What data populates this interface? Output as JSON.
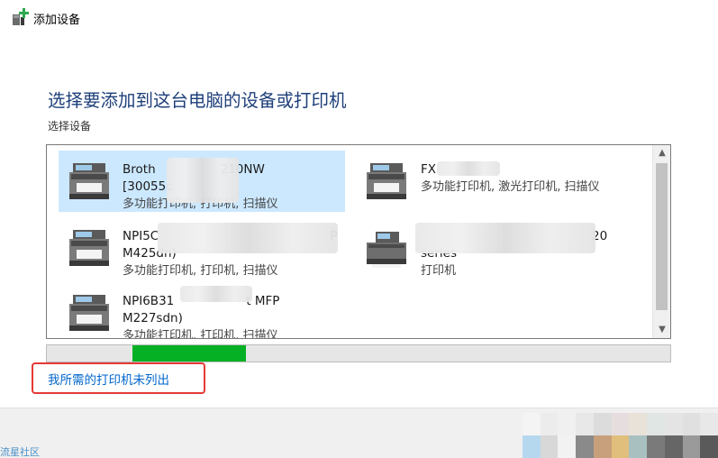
{
  "window": {
    "title": "添加设备",
    "icon": "add-device-icon"
  },
  "heading": "选择要添加到这台电脑的设备或打印机",
  "subheading": "选择设备",
  "devices": [
    {
      "line1": "Broth",
      "line1_tail": "210NW",
      "line2": "[30055c",
      "line3": "多功能打印机, 打印机, 扫描仪",
      "icon": "multifunction-printer-icon",
      "selected": true
    },
    {
      "line1": "FX",
      "line1_tail": "",
      "line2": "",
      "line3": "多功能打印机, 激光打印机, 扫描仪",
      "icon": "multifunction-printer-icon",
      "selected": false
    },
    {
      "line1": "NPI5C",
      "line1_tail": "P",
      "line2": "M425dn)",
      "line3": "多功能打印机, 打印机, 扫描仪",
      "icon": "multifunction-printer-icon",
      "selected": false
    },
    {
      "line1": "",
      "line1_tail": "20",
      "line2": "series",
      "line3": "打印机",
      "icon": "printer-icon",
      "selected": false
    },
    {
      "line1": "NPI6B31",
      "line1_tail": "t MFP",
      "line2": "M227sdn)",
      "line3": "多功能打印机, 打印机, 扫描仪",
      "icon": "multifunction-printer-icon",
      "selected": false
    }
  ],
  "progress": {
    "start_fraction": 0.137,
    "end_fraction": 0.32,
    "color": "#06b025"
  },
  "not_listed_link": "我所需的打印机未列出",
  "watermark": "流星社区",
  "colors": {
    "heading": "#1e3f7a",
    "link": "#0066cc",
    "selection": "#cce8ff",
    "highlight_box": "#e53935"
  }
}
